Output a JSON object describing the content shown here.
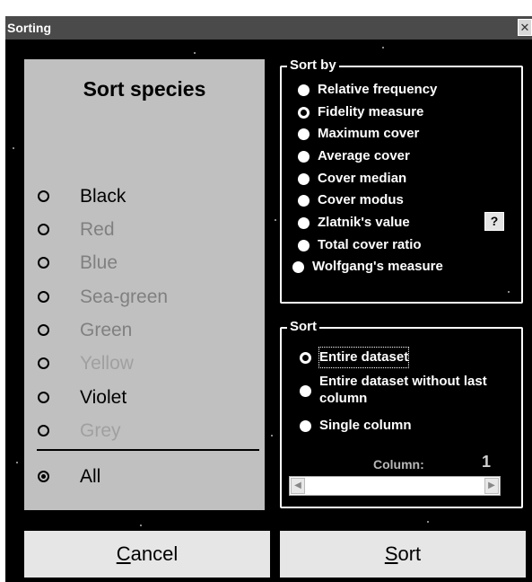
{
  "window": {
    "title": "Sorting",
    "close_glyph": "✕"
  },
  "species": {
    "title": "Sort species",
    "items": [
      {
        "label": "Black",
        "checked": false,
        "tone": "normal"
      },
      {
        "label": "Red",
        "checked": false,
        "tone": "dim"
      },
      {
        "label": "Blue",
        "checked": false,
        "tone": "dim"
      },
      {
        "label": "Sea-green",
        "checked": false,
        "tone": "dim"
      },
      {
        "label": "Green",
        "checked": false,
        "tone": "dim"
      },
      {
        "label": "Yellow",
        "checked": false,
        "tone": "dim2"
      },
      {
        "label": "Violet",
        "checked": false,
        "tone": "normal"
      },
      {
        "label": "Grey",
        "checked": false,
        "tone": "dim2"
      }
    ],
    "all": {
      "label": "All",
      "checked": true
    }
  },
  "sort_by": {
    "caption": "Sort by",
    "options": [
      {
        "label": "Relative frequency",
        "checked": false
      },
      {
        "label": "Fidelity measure",
        "checked": true
      },
      {
        "label": "Maximum cover",
        "checked": false
      },
      {
        "label": "Average cover",
        "checked": false
      },
      {
        "label": "Cover median",
        "checked": false
      },
      {
        "label": "Cover modus",
        "checked": false
      },
      {
        "label": "Zlatnik's value",
        "checked": false
      },
      {
        "label": "Total cover ratio",
        "checked": false
      },
      {
        "label": "Wolfgang's measure",
        "checked": false
      }
    ],
    "help_label": "?"
  },
  "sort": {
    "caption": "Sort",
    "options": [
      {
        "label": "Entire dataset",
        "checked": true
      },
      {
        "label": "Entire dataset without last column",
        "checked": false
      },
      {
        "label": "Single column",
        "checked": false
      }
    ],
    "column_label": "Column:",
    "column_value": "1",
    "scroll_left": "◀",
    "scroll_right": "▶"
  },
  "buttons": {
    "cancel_mnemonic": "C",
    "cancel_rest": "ancel",
    "sort_mnemonic": "S",
    "sort_rest": "ort"
  },
  "colors": {
    "background": "#000000",
    "panel": "#c0c0c0",
    "titlebar": "#4a4a4a",
    "button": "#e6e6e6"
  }
}
